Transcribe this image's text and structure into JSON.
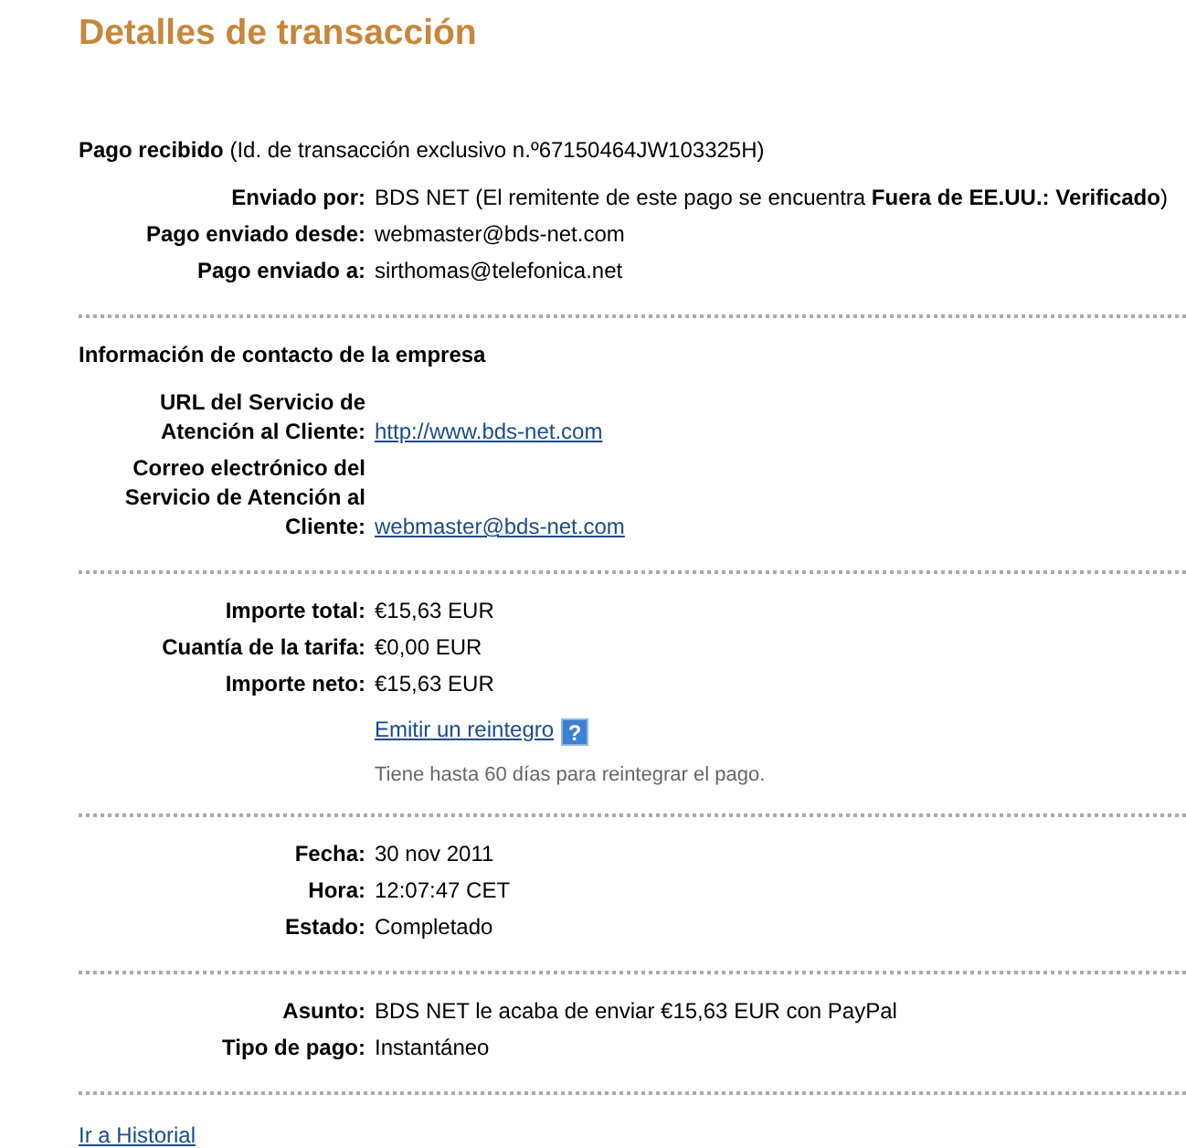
{
  "title": "Detalles de transacción",
  "sections": [
    {
      "heading": "**Pago recibido** (Id. de transacción exclusivo n.º67150464JW103325H)",
      "rows": [
        {
          "label": "Enviado por:",
          "value": "BDS NET (El remitente de este pago se encuentra **Fuera de EE.UU.: Verificado**)",
          "kind": "text"
        },
        {
          "label": "Pago enviado desde:",
          "value": "webmaster@bds-net.com",
          "kind": "text"
        },
        {
          "label": "Pago enviado a:",
          "value": "sirthomas@telefonica.net",
          "kind": "text"
        }
      ]
    },
    {
      "heading": "**Información de contacto de la empresa**",
      "rows": [
        {
          "label": "URL del Servicio de Atención al Cliente:",
          "value": "http://www.bds-net.com",
          "kind": "link"
        },
        {
          "label": "Correo electrónico del Servicio de Atención al Cliente:",
          "value": "webmaster@bds-net.com",
          "kind": "link"
        }
      ]
    },
    {
      "rows": [
        {
          "label": "Importe total:",
          "value": "€15,63 EUR",
          "kind": "text"
        },
        {
          "label": "Cuantía de la tarifa:",
          "value": "€0,00 EUR",
          "kind": "text"
        },
        {
          "label": "Importe neto:",
          "value": "€15,63 EUR",
          "kind": "text"
        }
      ],
      "refund": {
        "link": "Emitir un reintegro",
        "help": "?",
        "note": "Tiene hasta 60 días para reintegrar el pago."
      }
    },
    {
      "rows": [
        {
          "label": "Fecha:",
          "value": "30 nov 2011",
          "kind": "text"
        },
        {
          "label": "Hora:",
          "value": "12:07:47 CET",
          "kind": "text"
        },
        {
          "label": "Estado:",
          "value": "Completado",
          "kind": "text"
        }
      ]
    },
    {
      "rows": [
        {
          "label": "Asunto:",
          "value": "BDS NET le acaba de enviar €15,63 EUR con PayPal",
          "kind": "text"
        },
        {
          "label": "Tipo de pago:",
          "value": "Instantáneo",
          "kind": "text"
        }
      ]
    }
  ],
  "history_link": "Ir a Historial"
}
